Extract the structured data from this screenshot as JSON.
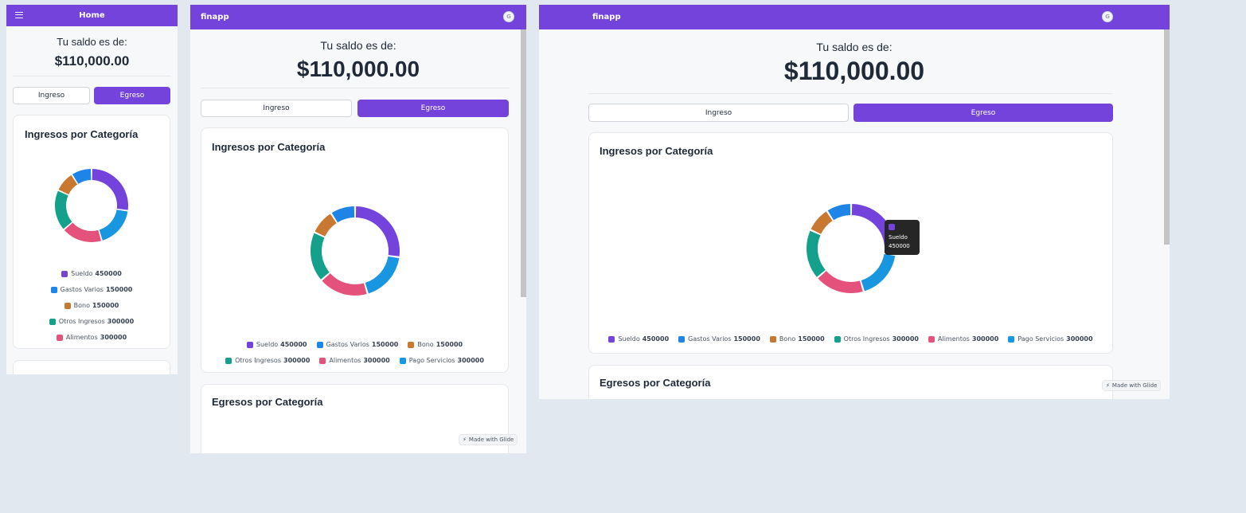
{
  "app": {
    "name": "finapp",
    "home_title": "Home",
    "avatar_letter": "G",
    "made_with": "Made with Glide"
  },
  "balance": {
    "label": "Tu saldo es de:",
    "amount": "$110,000.00"
  },
  "buttons": {
    "ingreso": "Ingreso",
    "egreso": "Egreso"
  },
  "cards": {
    "ingresos_title": "Ingresos por Categoría",
    "egresos_title": "Egresos por Categoría"
  },
  "chart_data": {
    "type": "pie",
    "title": "Ingresos por Categoría",
    "categories": [
      "Sueldo",
      "Gastos Varios",
      "Bono",
      "Otros Ingresos",
      "Alimentos",
      "Pago Servicios"
    ],
    "values": [
      450000,
      150000,
      150000,
      300000,
      300000,
      300000
    ],
    "colors": [
      "#7443dc",
      "#1e84e8",
      "#c8782f",
      "#15a08c",
      "#e4527c",
      "#1897e0"
    ],
    "order": [
      "Sueldo",
      "Pago Servicios",
      "Alimentos",
      "Otros Ingresos",
      "Bono",
      "Gastos Varios"
    ],
    "legend": "bottom"
  },
  "legend": [
    {
      "name": "Sueldo",
      "value": "450000",
      "color": "#7443dc"
    },
    {
      "name": "Gastos Varios",
      "value": "150000",
      "color": "#1e84e8"
    },
    {
      "name": "Bono",
      "value": "150000",
      "color": "#c8782f"
    },
    {
      "name": "Otros Ingresos",
      "value": "300000",
      "color": "#15a08c"
    },
    {
      "name": "Alimentos",
      "value": "300000",
      "color": "#e4527c"
    },
    {
      "name": "Pago Servicios",
      "value": "300000",
      "color": "#1897e0"
    }
  ],
  "tooltip": {
    "name": "Sueldo",
    "value": "450000"
  }
}
